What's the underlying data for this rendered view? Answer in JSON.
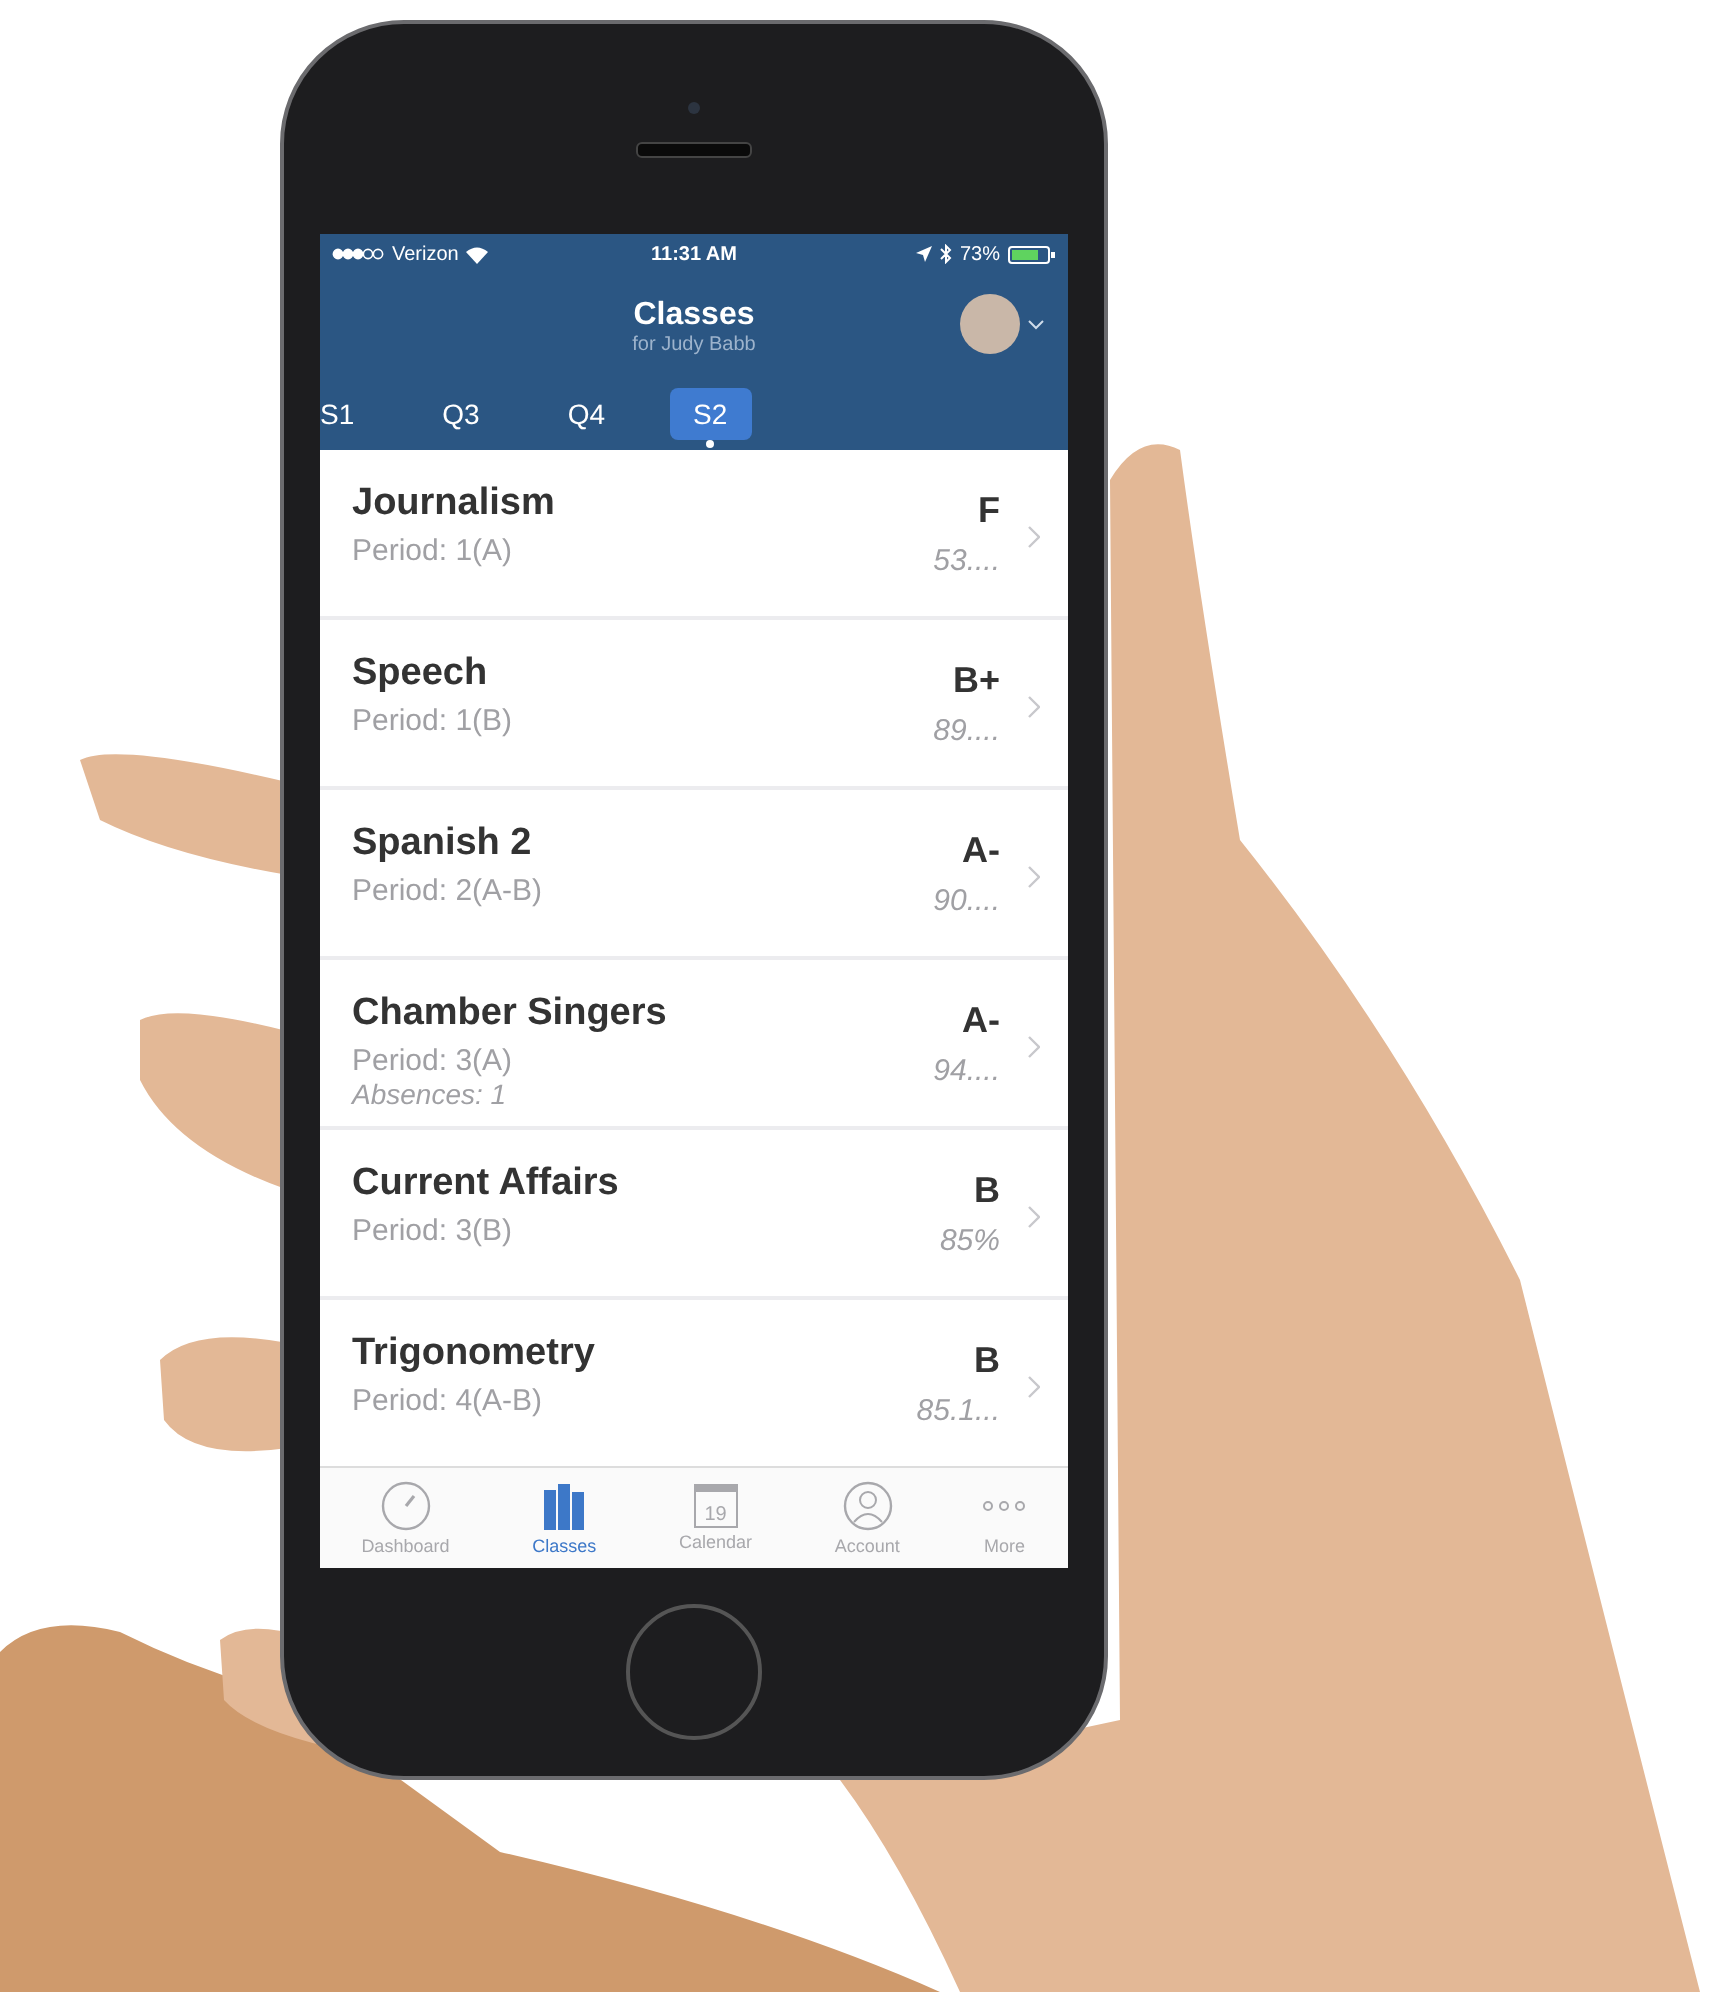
{
  "status_bar": {
    "carrier": "Verizon",
    "time": "11:31 AM",
    "battery": "73%"
  },
  "header": {
    "title": "Classes",
    "subtitle": "for Judy Babb"
  },
  "tabs": [
    {
      "label": "S1",
      "selected": false
    },
    {
      "label": "Q3",
      "selected": false
    },
    {
      "label": "Q4",
      "selected": false
    },
    {
      "label": "S2",
      "selected": true
    }
  ],
  "classes": [
    {
      "name": "Journalism",
      "period": "Period: 1(A)",
      "grade": "F",
      "percent": "53...."
    },
    {
      "name": "Speech",
      "period": "Period: 1(B)",
      "grade": "B+",
      "percent": "89...."
    },
    {
      "name": "Spanish 2",
      "period": "Period: 2(A-B)",
      "grade": "A-",
      "percent": "90...."
    },
    {
      "name": "Chamber Singers",
      "period": "Period: 3(A)",
      "absences": "Absences: 1",
      "grade": "A-",
      "percent": "94...."
    },
    {
      "name": "Current Affairs",
      "period": "Period: 3(B)",
      "grade": "B",
      "percent": "85%"
    },
    {
      "name": "Trigonometry",
      "period": "Period: 4(A-B)",
      "grade": "B",
      "percent": "85.1..."
    }
  ],
  "tab_bar": [
    {
      "label": "Dashboard",
      "kind": "gauge",
      "selected": false
    },
    {
      "label": "Classes",
      "kind": "books",
      "selected": true
    },
    {
      "label": "Calendar",
      "kind": "calendar",
      "selected": false,
      "icon_text": "19"
    },
    {
      "label": "Account",
      "kind": "person",
      "selected": false
    },
    {
      "label": "More",
      "kind": "dots",
      "selected": false
    }
  ]
}
